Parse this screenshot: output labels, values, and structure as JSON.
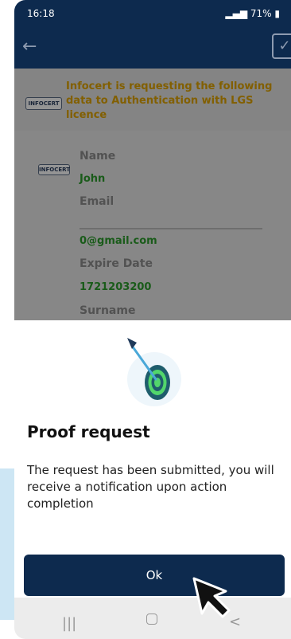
{
  "status_bar": {
    "time": "16:18",
    "battery": "71%"
  },
  "request": {
    "message": "Infocert is requesting the following data to Authentication with LGS licence",
    "logo_text": "INFOCERT"
  },
  "fields": [
    {
      "label": "Name",
      "value": "John"
    },
    {
      "label": "Email",
      "value": "0@gmail.com"
    },
    {
      "label": "Expire Date",
      "value": "1721203200"
    },
    {
      "label": "Surname",
      "value": ""
    }
  ],
  "dialog": {
    "title": "Proof request",
    "message": "The request has been submitted, you will receive a notification upon action completion",
    "ok_label": "Ok"
  },
  "nav": {
    "recents": "|||",
    "back": "<"
  },
  "icons": [
    "back-arrow-icon",
    "checklist-icon",
    "target-icon",
    "mouse-cursor-icon",
    "home-icon"
  ]
}
